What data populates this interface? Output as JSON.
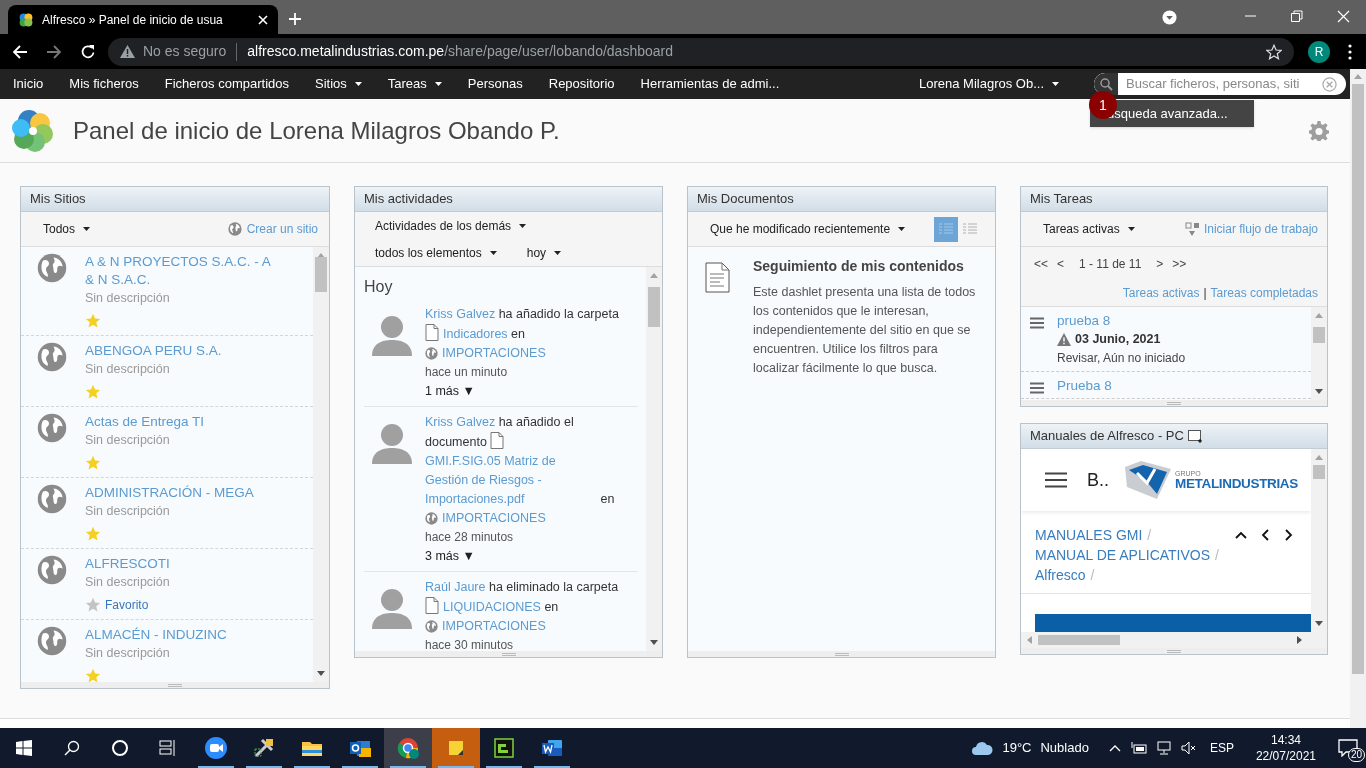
{
  "browser": {
    "tab_title": "Alfresco » Panel de inicio de usua",
    "security": "No es seguro",
    "url_host": "alfresco.metalindustrias.com.pe",
    "url_path": "/share/page/user/lobando/dashboard",
    "profile": "R"
  },
  "nav": {
    "items": [
      {
        "label": "Inicio",
        "dropdown": false
      },
      {
        "label": "Mis ficheros",
        "dropdown": false
      },
      {
        "label": "Ficheros compartidos",
        "dropdown": false
      },
      {
        "label": "Sitios",
        "dropdown": true
      },
      {
        "label": "Tareas",
        "dropdown": true
      },
      {
        "label": "Personas",
        "dropdown": false
      },
      {
        "label": "Repositorio",
        "dropdown": false
      },
      {
        "label": "Herramientas de admi...",
        "dropdown": false
      }
    ],
    "user": "Lorena Milagros Ob...",
    "search_placeholder": "Buscar ficheros, personas, siti"
  },
  "search_menu": {
    "badge": "1",
    "item": "usqueda avanzada..."
  },
  "title": "Panel de inicio de Lorena Milagros Obando P.",
  "sites": {
    "title": "Mis Sitios",
    "filter": "Todos",
    "create": "Crear un sitio",
    "items": [
      {
        "name": "A & N PROYECTOS S.A.C. - A & N S.A.C.",
        "description": "Sin descripción",
        "favorite": true
      },
      {
        "name": "ABENGOA PERU S.A.",
        "description": "Sin descripción",
        "favorite": true
      },
      {
        "name": "Actas de Entrega TI",
        "description": "Sin descripción",
        "favorite": true
      },
      {
        "name": "ADMINISTRACIÓN - MEGA",
        "description": "Sin descripción",
        "favorite": true
      },
      {
        "name": "ALFRESCOTI",
        "description": "Sin descripción",
        "favorite": false,
        "favorite_label": "Favorito"
      },
      {
        "name": "ALMACÉN - INDUZINC",
        "description": "Sin descripción",
        "favorite": true
      }
    ]
  },
  "activities": {
    "title": "Mis actividades",
    "filters": [
      "Actividades de los demás",
      "todos los elementos",
      "hoy"
    ],
    "day": "Hoy",
    "items": [
      {
        "user": "Kriss Galvez",
        "action": "ha añadido la carpeta",
        "item": "Indicadores",
        "connector": "en",
        "site": "IMPORTACIONES",
        "time": "hace un minuto",
        "more": "1 más ▼"
      },
      {
        "user": "Kriss Galvez",
        "action": "ha añadido el documento",
        "item": "GMI.F.SIG.05 Matriz de Gestión de Riesgos - Importaciones.pdf",
        "connector": "en",
        "site": "IMPORTACIONES",
        "time": "hace 28 minutos",
        "more": "3 más ▼"
      },
      {
        "user": "Raúl Jaure",
        "action": "ha eliminado la carpeta",
        "item": "LIQUIDACIONES",
        "connector": "en",
        "site": "IMPORTACIONES",
        "time": "hace 30 minutos"
      }
    ]
  },
  "documents": {
    "title": "Mis Documentos",
    "filter": "Que he modificado recientemente",
    "views": [
      {
        "selected": true
      },
      {
        "selected": false
      }
    ],
    "empty_title": "Seguimiento de mis contenidos",
    "empty_text": "Este dashlet presenta una lista de todos los contenidos que le interesan, independientemente del sitio en que se encuentren. Utilice los filtros para localizar fácilmente lo que busca."
  },
  "tasks": {
    "title": "Mis Tareas",
    "filter": "Tareas activas",
    "start": "Iniciar flujo de trabajo",
    "pager": {
      "first": "<<",
      "prev": "<",
      "range": "1 - 11 de 11",
      "next": ">",
      "last": ">>"
    },
    "links": [
      "Tareas activas",
      "Tareas completadas"
    ],
    "separator": "|",
    "items": [
      {
        "name": "prueba 8",
        "date": "03 Junio, 2021",
        "status": "Revisar, Aún no iniciado"
      },
      {
        "name": "Prueba 8"
      }
    ]
  },
  "manuals": {
    "title": "Manuales de Alfresco - PC",
    "header_text": "B..",
    "logo_small": "GRUPO",
    "logo_name": "METALINDUSTRIAS",
    "breadcrumb": [
      "MANUALES GMI",
      "MANUAL DE APLICATIVOS",
      "Alfresco"
    ],
    "separator": "/"
  },
  "taskbar": {
    "apps": [
      {
        "kind": "zoom",
        "selected": false
      },
      {
        "kind": "tools",
        "selected": false
      },
      {
        "kind": "folder",
        "selected": false
      },
      {
        "kind": "outlook",
        "selected": false
      },
      {
        "kind": "chrome",
        "selected": true
      },
      {
        "kind": "notes",
        "selected": false
      },
      {
        "kind": "green",
        "selected": false
      },
      {
        "kind": "word",
        "selected": false
      }
    ],
    "temperature": "19°C",
    "weather": "Nublado",
    "language": "ESP",
    "time": "14:34",
    "date": "22/07/2021",
    "notifications": "20"
  }
}
